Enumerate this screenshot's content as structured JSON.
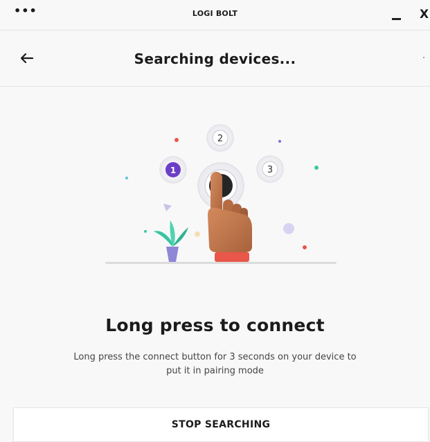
{
  "window": {
    "menu_icon": "more-horizontal-icon",
    "title": "LOGI BOLT",
    "minimize_icon": "minimize-icon",
    "close_icon": "close-icon",
    "close_glyph": "X"
  },
  "header": {
    "back_icon": "arrow-left-icon",
    "title": "Searching devices..."
  },
  "illustration": {
    "step_numbers": [
      "1",
      "2",
      "3"
    ],
    "active_step": "1",
    "colors": {
      "active_step": "#6b3ec7",
      "finger_skin": "#c47a4e",
      "cuff": "#e8574a",
      "button": "#262626",
      "plant": "#37c4a2",
      "pot": "#8d87d6"
    }
  },
  "content": {
    "headline": "Long press to connect",
    "description": "Long press the connect button for 3 seconds on your device to put it in pairing mode"
  },
  "actions": {
    "stop_label": "STOP SEARCHING"
  }
}
